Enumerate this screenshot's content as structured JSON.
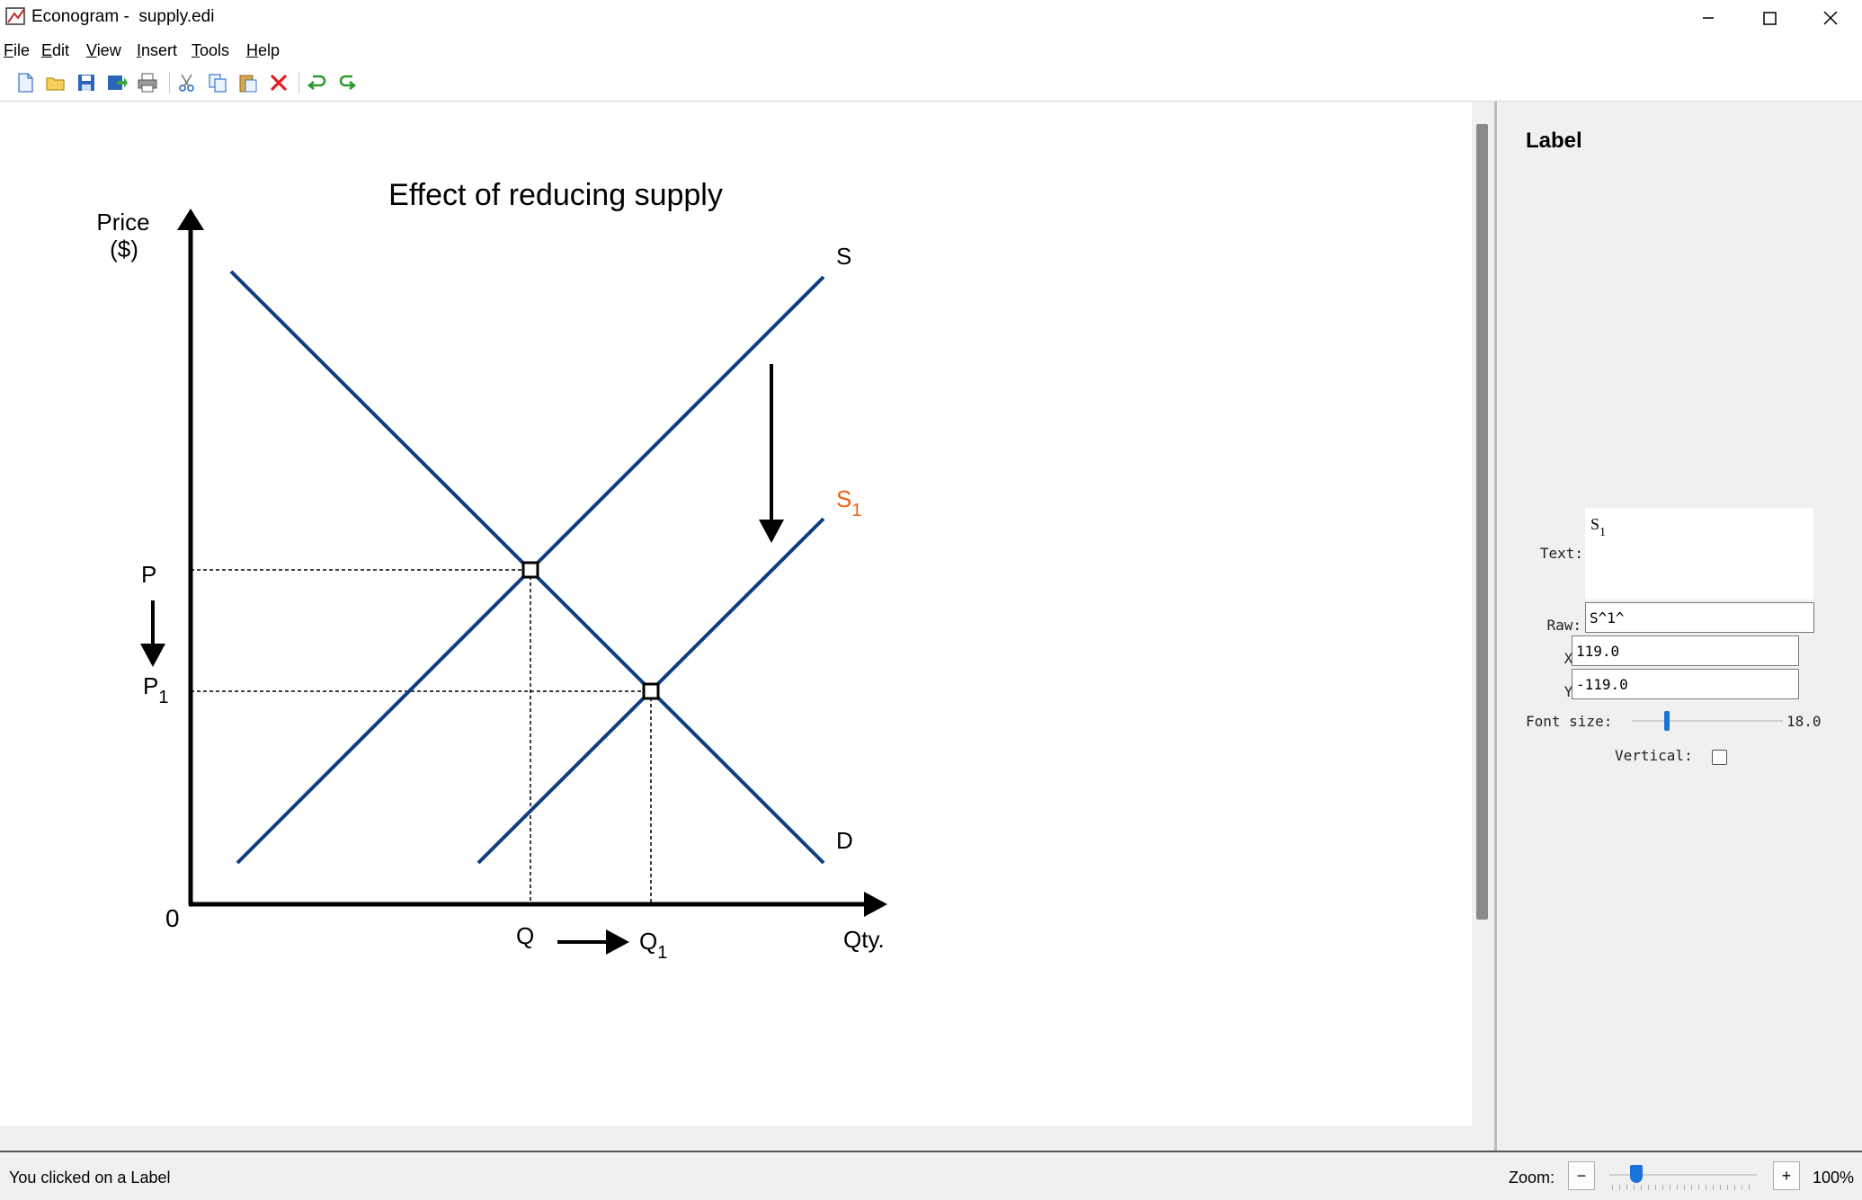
{
  "window": {
    "title": "Econogram -  supply.edi",
    "minimize_icon": "minimize-icon",
    "maximize_icon": "maximize-icon",
    "close_icon": "close-icon"
  },
  "menu": [
    {
      "label": "File",
      "mnemonic": "F",
      "rest": "ile"
    },
    {
      "label": "Edit",
      "mnemonic": "E",
      "rest": "dit"
    },
    {
      "label": "View",
      "mnemonic": "V",
      "rest": "iew"
    },
    {
      "label": "Insert",
      "mnemonic": "I",
      "rest": "nsert"
    },
    {
      "label": "Tools",
      "mnemonic": "T",
      "rest": "ools"
    },
    {
      "label": "Help",
      "mnemonic": "H",
      "rest": "elp"
    }
  ],
  "toolbar": {
    "buttons": [
      "new-file-icon",
      "open-folder-icon",
      "save-icon",
      "export-image-icon",
      "print-icon",
      "cut-icon",
      "copy-icon",
      "paste-icon",
      "delete-icon",
      "undo-icon",
      "redo-icon"
    ],
    "colors": {
      "delete": "#e02020",
      "undo_redo": "#2e9a2e"
    }
  },
  "diagram": {
    "title": "Effect of reducing supply",
    "y_axis_label_line1": "Price",
    "y_axis_label_line2": "($)",
    "x_axis_label": "Qty.",
    "origin_label": "0",
    "supply_label": "S",
    "supply1_label": "S",
    "supply1_sub": "1",
    "demand_label": "D",
    "price_label": "P",
    "price1_label": "P",
    "price1_sub": "1",
    "qty_label": "Q",
    "qty1_label": "Q",
    "qty1_sub": "1",
    "colors": {
      "curve": "#0f3e80",
      "selected_label": "#f06018",
      "axis": "#000000"
    }
  },
  "panel": {
    "title": "Label",
    "text_label": "Text:",
    "text_preview_base": "S",
    "text_preview_sub": "1",
    "raw_label": "Raw:",
    "raw_value": "S^1^",
    "x_label": "X:",
    "x_value": "119.0",
    "y_label": "Y:",
    "y_value": "-119.0",
    "font_size_label": "Font size:",
    "font_size_value": "18.0",
    "vertical_label": "Vertical:",
    "vertical_checked": false
  },
  "status": {
    "message": "You clicked on a Label",
    "zoom_label": "Zoom:",
    "zoom_minus": "−",
    "zoom_plus": "+",
    "zoom_value": "100%"
  }
}
